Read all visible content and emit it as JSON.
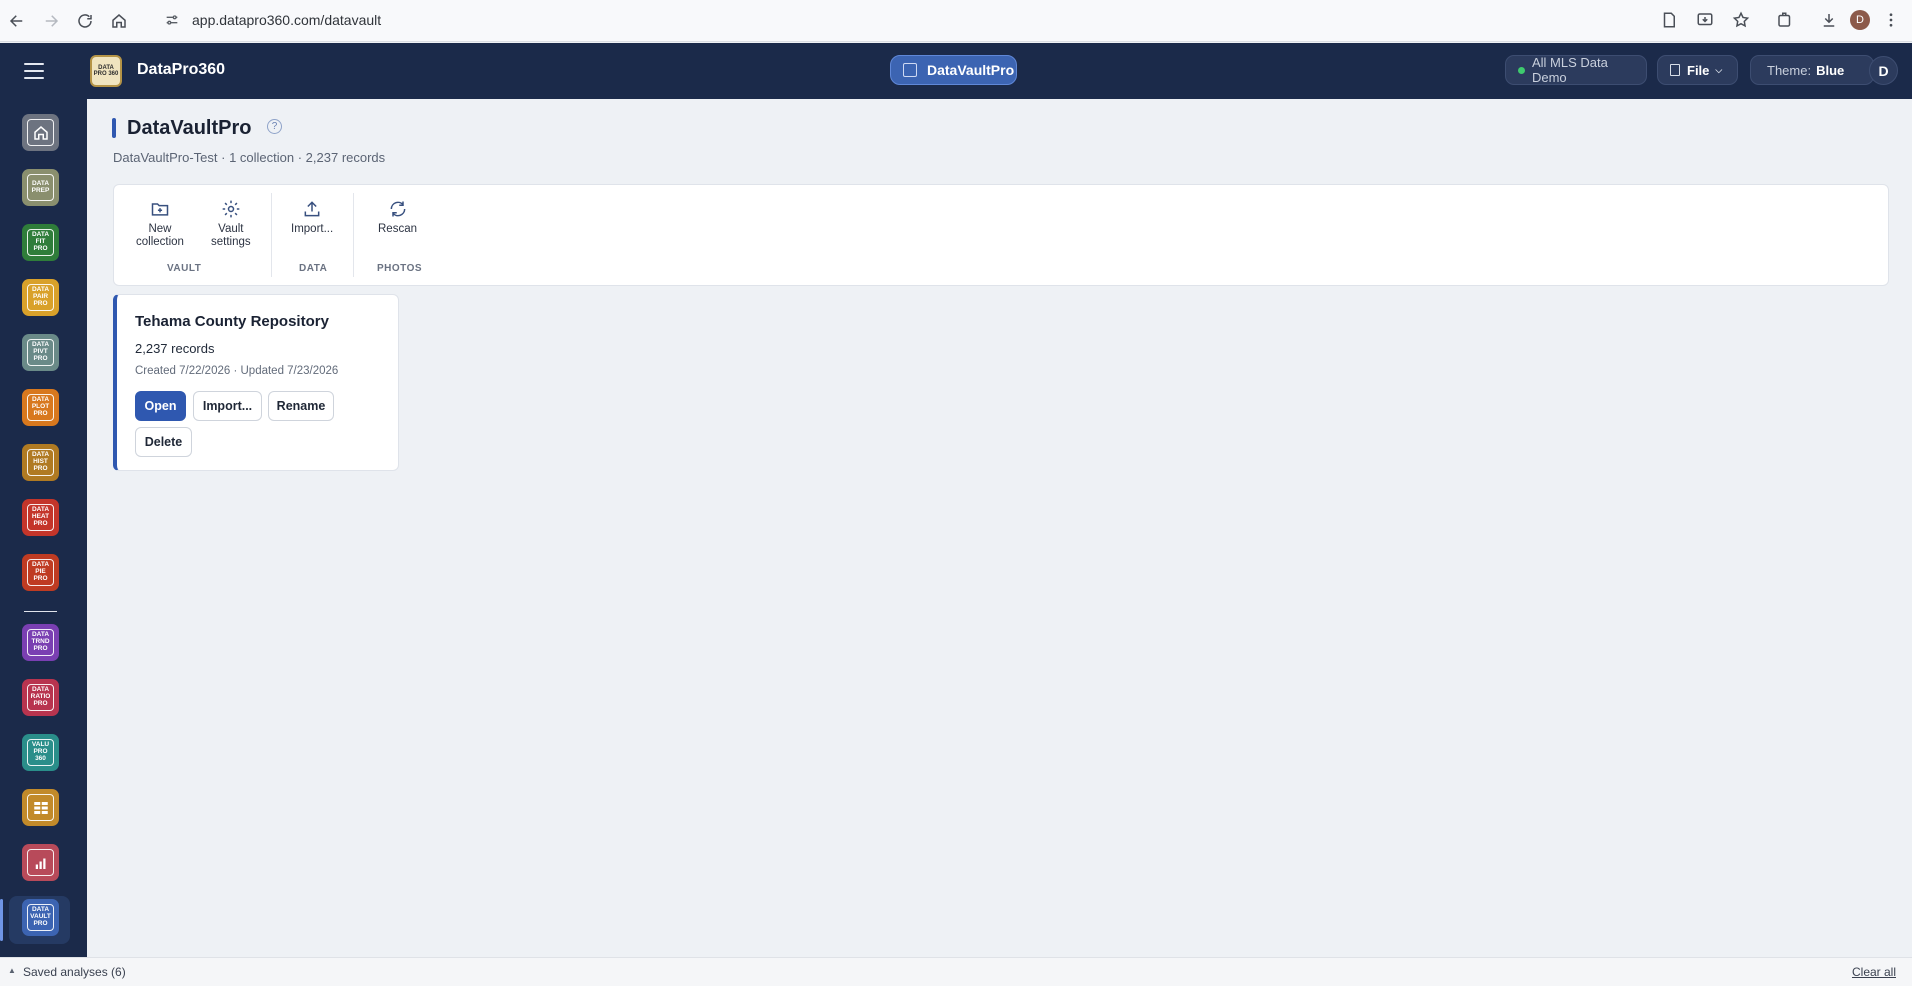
{
  "browser": {
    "url": "app.datapro360.com/datavault",
    "profile_initial": "D"
  },
  "header": {
    "logo_text": "DATA PRO 360",
    "app_name": "DataPro360",
    "module_label": "DataVaultPro",
    "dataset_label": "All MLS Data Demo",
    "file_label": "File",
    "theme_prefix": "Theme:",
    "theme_value": "Blue",
    "user_initial": "D",
    "status_color": "#3ecb6e"
  },
  "sidebar": {
    "items": [
      {
        "label": "",
        "icon": "home-icon",
        "color": "#6d7380"
      },
      {
        "label": "DATA PREP",
        "color": "#8a8f6e"
      },
      {
        "label": "DATA FIT PRO",
        "color": "#2f7d3a"
      },
      {
        "label": "DATA PAIR PRO",
        "color": "#d9a12a"
      },
      {
        "label": "DATA PIVT PRO",
        "color": "#6a8a88"
      },
      {
        "label": "DATA PLOT PRO",
        "color": "#d8781e"
      },
      {
        "label": "DATA HIST PRO",
        "color": "#b07a22"
      },
      {
        "label": "DATA HEAT PRO",
        "color": "#c4352a"
      },
      {
        "label": "DATA PIE PRO",
        "color": "#bf3b22"
      },
      {
        "label": "DATA TRND PRO",
        "color": "#7a3fb2"
      },
      {
        "label": "DATA RATIO PRO",
        "color": "#b8344f"
      },
      {
        "label": "VALU PRO 360",
        "color": "#2a8e8a"
      },
      {
        "label": "",
        "icon": "grid-report-icon",
        "color": "#c28a2a"
      },
      {
        "label": "",
        "icon": "bar-report-icon",
        "color": "#b84a5a"
      },
      {
        "label": "DATA VAULT PRO",
        "color": "#3c64b2"
      }
    ]
  },
  "page": {
    "title": "DataVaultPro",
    "help": "?",
    "subtitle": "DataVaultPro-Test · 1 collection · 2,237 records"
  },
  "toolbar": {
    "new_collection": "New\ncollection",
    "vault_settings": "Vault\nsettings",
    "import": "Import...",
    "rescan": "Rescan",
    "groups": {
      "vault": "VAULT",
      "data": "DATA",
      "photos": "PHOTOS"
    }
  },
  "collection": {
    "name": "Tehama County Repository",
    "records": "2,237 records",
    "dates": "Created 7/22/2026 · Updated 7/23/2026",
    "open": "Open",
    "import": "Import...",
    "rename": "Rename",
    "delete": "Delete"
  },
  "footer": {
    "caret": "▲",
    "saved": "Saved analyses (6)",
    "clear": "Clear all"
  }
}
